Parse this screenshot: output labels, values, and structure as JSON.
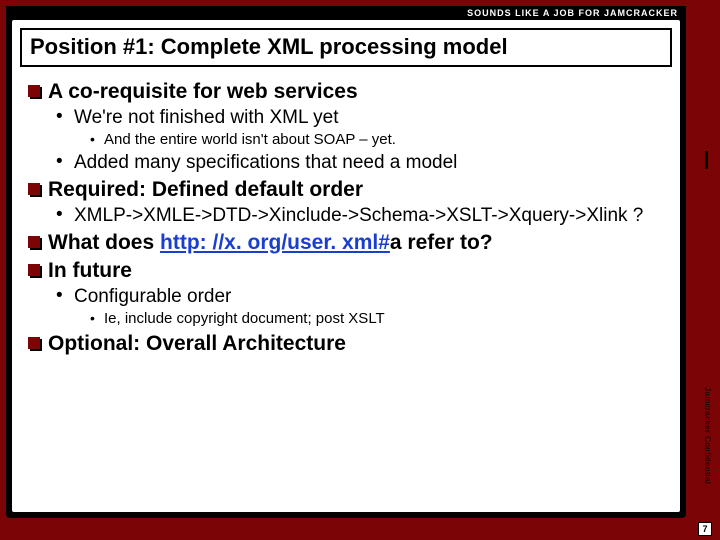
{
  "topStrip": "SOUNDS LIKE A JOB FOR JAMCRACKER",
  "brand": "jamcracker",
  "confidential": "Jamcracker Confidential",
  "pageNumber": "7",
  "title": "Position #1: Complete XML processing model",
  "items": {
    "h1": "A co-requisite for web services",
    "h1a": "We're not finished with XML yet",
    "h1a1": "And the entire world isn't about SOAP – yet.",
    "h1b": "Added many specifications that need a model",
    "h2": "Required: Defined default order",
    "h2a": "XMLP->XMLE->DTD->Xinclude->Schema->XSLT->Xquery->Xlink ?",
    "h3_pre": "What does ",
    "h3_link": "http: //x. org/user. xml#",
    "h3_post": "a refer to?",
    "h4": "In future",
    "h4a": "Configurable order",
    "h4a1": "Ie, include copyright document; post XSLT",
    "h5": "Optional: Overall Architecture"
  }
}
